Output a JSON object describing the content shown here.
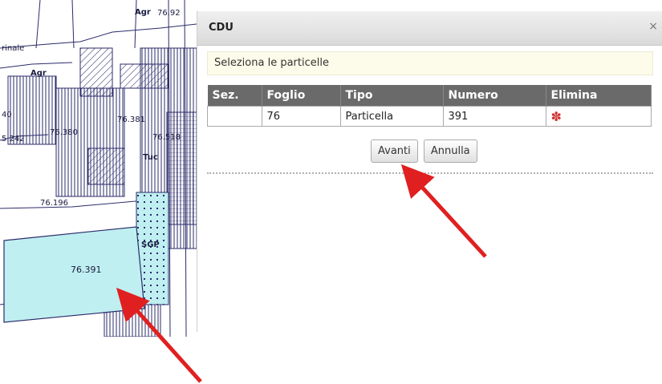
{
  "map": {
    "labels": {
      "agr_top": "Agr",
      "agr_top_num": "76.92",
      "agr_left": "Agr",
      "tinale": "rinale",
      "n_40": "40",
      "n_5242": "5.242",
      "n_76380": "76.380",
      "n_76381": "76.381",
      "n_76518": "76.518",
      "tuc": "Tuc",
      "n_76196": "76.196",
      "sgp": "SGP",
      "n_76391": "76.391"
    }
  },
  "dialog": {
    "title": "CDU",
    "close_glyph": "×",
    "instruction": "Seleziona le particelle",
    "table": {
      "columns": [
        "Sez.",
        "Foglio",
        "Tipo",
        "Numero",
        "Elimina"
      ],
      "rows": [
        {
          "sez": "",
          "foglio": "76",
          "tipo": "Particella",
          "numero": "391",
          "elimina_icon": "delete-icon"
        }
      ]
    },
    "buttons": {
      "next": "Avanti",
      "cancel": "Annulla"
    }
  },
  "colors": {
    "header_bg": "#6a6a6a",
    "instruction_bg": "#fdfbe9",
    "arrow": "#e02020",
    "parcel_fill": "#bfeff0",
    "map_line": "#2b2b6b"
  }
}
